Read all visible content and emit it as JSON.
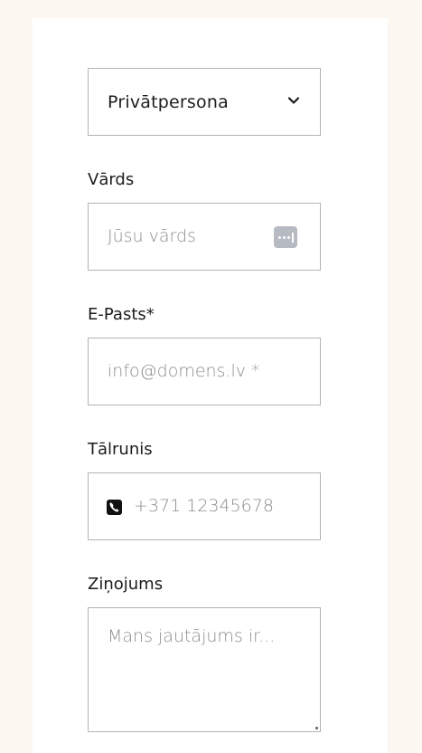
{
  "form": {
    "person_type": {
      "selected": "Privātpersona",
      "icon": "chevron-down-icon"
    },
    "name": {
      "label": "Vārds",
      "placeholder": "Jūsu vārds",
      "icon": "password-manager-icon"
    },
    "email": {
      "label": "E-Pasts*",
      "placeholder": "info@domens.lv *"
    },
    "phone": {
      "label": "Tālrunis",
      "placeholder": "+371 12345678",
      "icon": "phone-icon"
    },
    "message": {
      "label": "Ziņojums",
      "placeholder": "Mans jautājums ir..."
    }
  },
  "colors": {
    "page_background": "#fdf7f1",
    "card_background": "#ffffff",
    "field_border": "#b3b3b3",
    "placeholder_text": "#8d8d8d",
    "label_text": "#1c1c1c"
  }
}
